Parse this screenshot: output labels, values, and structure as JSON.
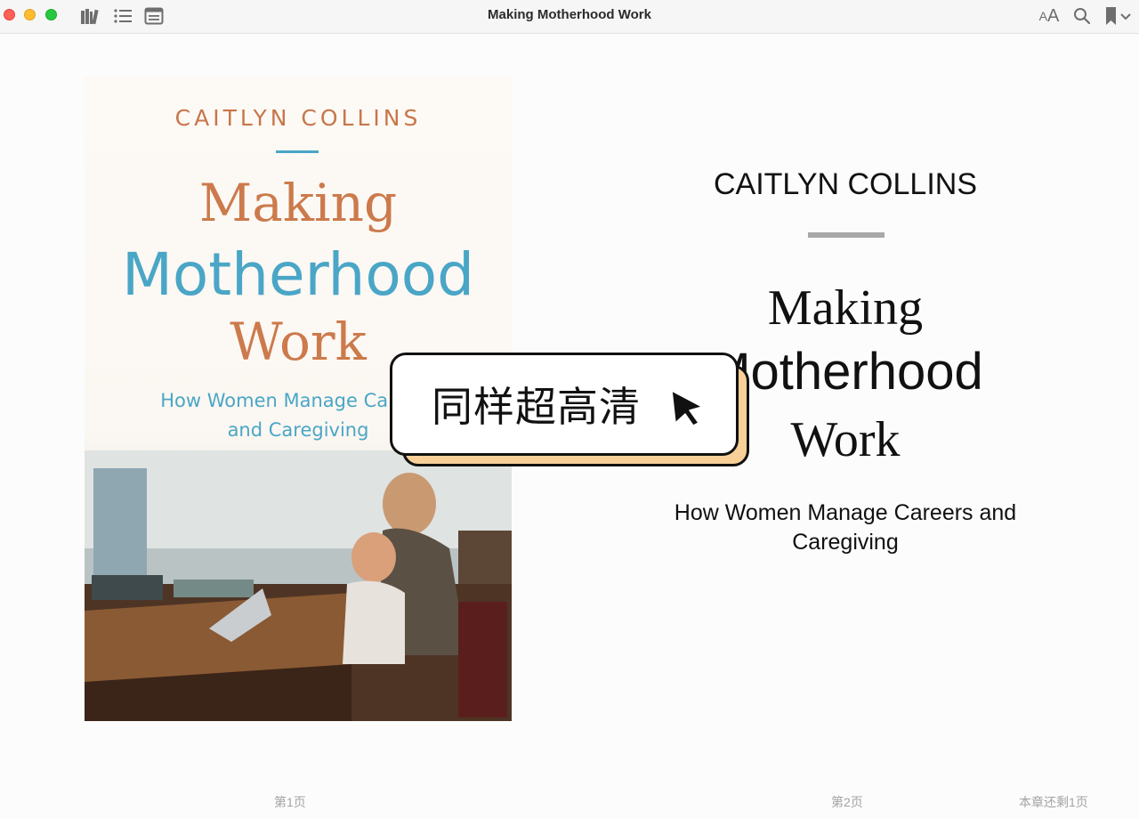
{
  "window": {
    "title": "Making Motherhood Work"
  },
  "toolbar": {
    "left_icons": [
      "library-icon",
      "table-of-contents-icon",
      "notes-icon"
    ],
    "right_icons": [
      "font-size-icon",
      "search-icon",
      "bookmark-icon"
    ],
    "font_size_label": "AA"
  },
  "cover": {
    "author": "CAITLYN COLLINS",
    "title_line1": "Making",
    "title_line2": "Motherhood",
    "title_line3": "Work",
    "subtitle_line1": "How Women Manage Careers",
    "subtitle_line2": "and Caregiving"
  },
  "page": {
    "author": "CAITLYN COLLINS",
    "title_line1": "Making",
    "title_line2": "Motherhood",
    "title_line3": "Work",
    "subtitle": "How Women Manage Careers and Caregiving"
  },
  "badge": {
    "text": "同样超高清"
  },
  "footer": {
    "left_page": "第1页",
    "right_page": "第2页",
    "remaining": "本章还剩1页"
  },
  "colors": {
    "cover_orange": "#cc7a4c",
    "cover_blue": "#4aa6c6",
    "badge_shadow": "#f7cf97"
  }
}
